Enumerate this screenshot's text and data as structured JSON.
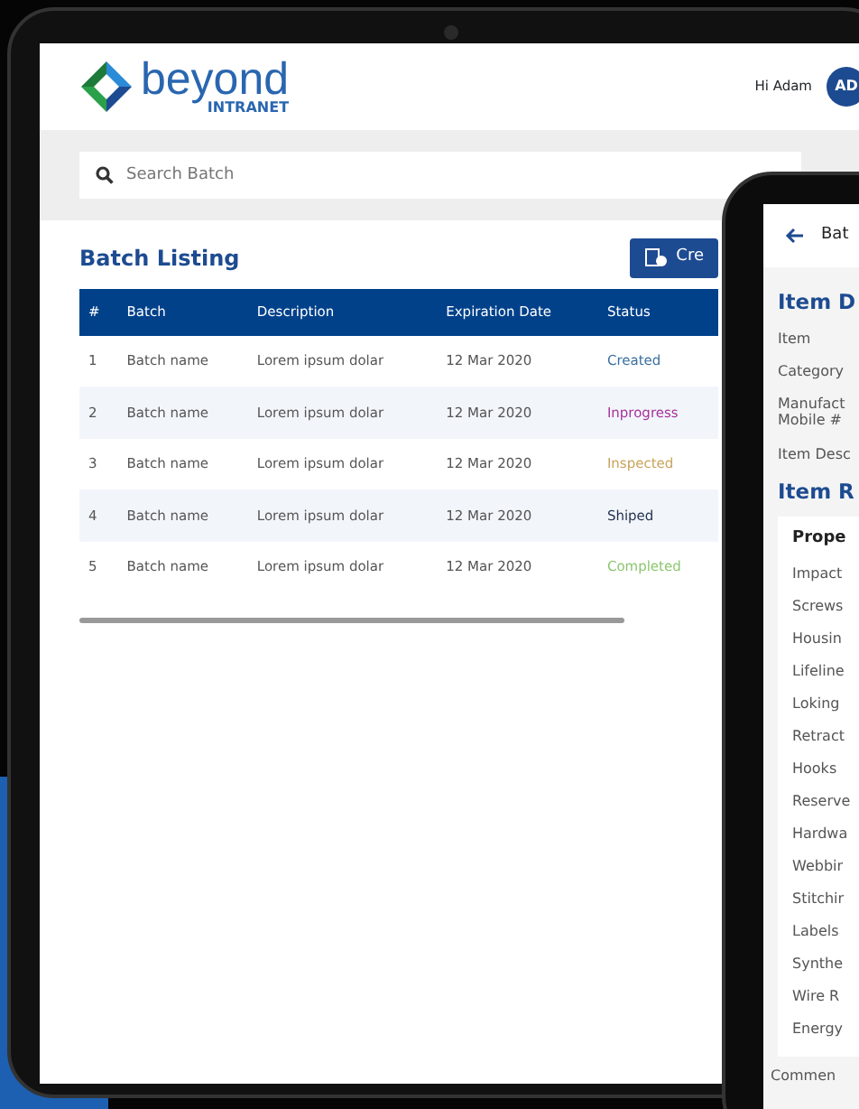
{
  "batch_screen": {
    "logo": {
      "word": "beyond",
      "subtitle": "INTRANET"
    },
    "greeting": "Hi Adam",
    "avatar": "AD",
    "search": {
      "placeholder": "Search Batch"
    },
    "title": "Batch Listing",
    "create_button": "Cre",
    "table": {
      "columns": [
        "#",
        "Batch",
        "Description",
        "Expiration Date",
        "Status"
      ],
      "rows": [
        {
          "cells": [
            "1",
            "Batch name",
            "Lorem ipsum dolar",
            "12 Mar 2020",
            "Created"
          ],
          "color": "#3a6fa0"
        },
        {
          "cells": [
            "2",
            "Batch name",
            "Lorem ipsum dolar",
            "12 Mar 2020",
            "Inprogress"
          ],
          "color": "#a8329a"
        },
        {
          "cells": [
            "3",
            "Batch name",
            "Lorem ipsum dolar",
            "12 Mar 2020",
            "Inspected"
          ],
          "color": "#c9a35a"
        },
        {
          "cells": [
            "4",
            "Batch name",
            "Lorem ipsum dolar",
            "12 Mar 2020",
            "Shiped"
          ],
          "color": "#1f2f4a"
        },
        {
          "cells": [
            "5",
            "Batch name",
            "Lorem ipsum dolar",
            "12 Mar 2020",
            "Completed"
          ],
          "color": "#8cc56e"
        }
      ]
    }
  },
  "item_screen": {
    "back_title": "Bat",
    "details_heading": "Item D",
    "detail_labels": [
      "Item",
      "Category",
      "Manufact Mobile #",
      "Item Desc"
    ],
    "results_heading": "Item R",
    "card_heading": "Prope",
    "properties": [
      "Impact",
      "Screws",
      "Housin",
      "Lifeline",
      "Loking",
      "Retract",
      "Hooks",
      "Reserve",
      "Hardwa",
      "Webbir",
      "Stitchir",
      "Labels",
      "Synthe",
      "Wire R",
      "Energy"
    ],
    "comment_label": "Commen"
  }
}
